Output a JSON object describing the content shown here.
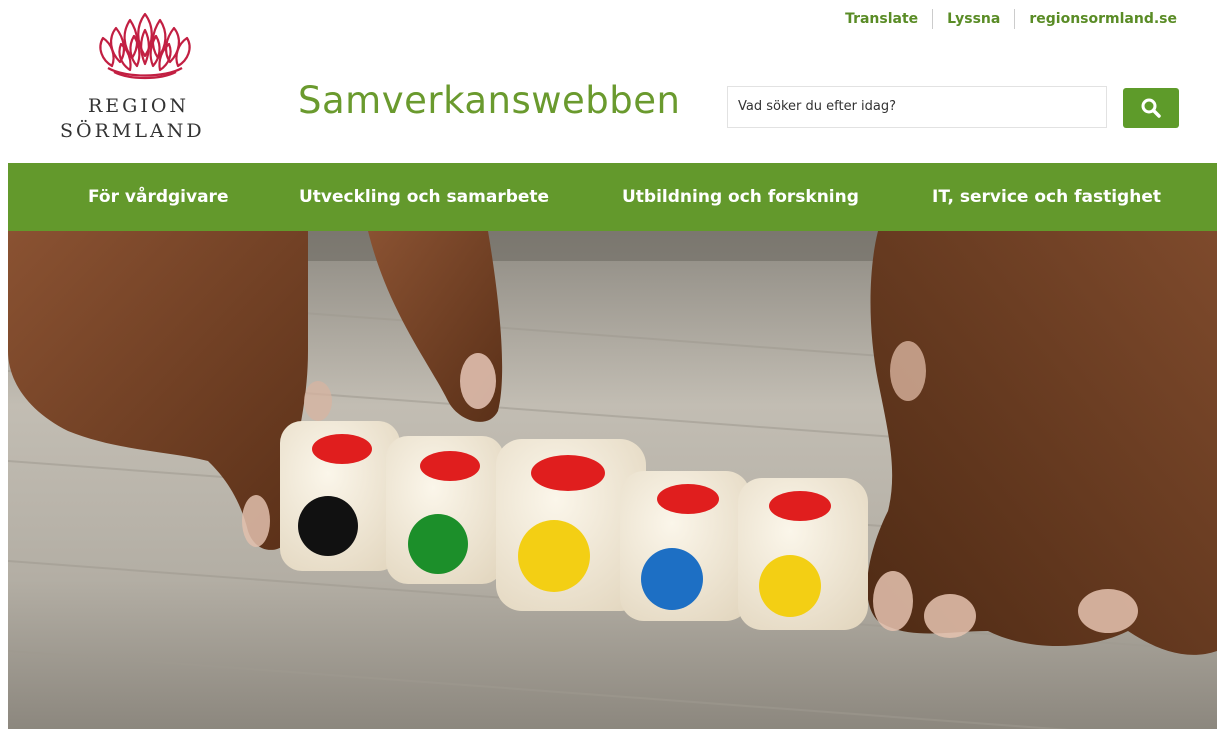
{
  "header": {
    "logo": {
      "line1": "REGION",
      "line2": "SÖRMLAND",
      "icon": "lotus-logo-icon",
      "color": "#c21f42"
    },
    "site_title": "Samverkanswebben",
    "toplinks": [
      "Translate",
      "Lyssna",
      "regionsormland.se"
    ],
    "search": {
      "placeholder": "Vad söker du efter idag?",
      "button_icon": "search-icon"
    }
  },
  "nav": {
    "items": [
      "För vårdgivare",
      "Utveckling och samarbete",
      "Utbildning och forskning",
      "IT, service och fastighet"
    ]
  },
  "colors": {
    "brand_green": "#63992c",
    "title_green": "#6a9a2e",
    "logo_red": "#c21f42"
  },
  "hero": {
    "image": "hands-with-colored-dice"
  }
}
